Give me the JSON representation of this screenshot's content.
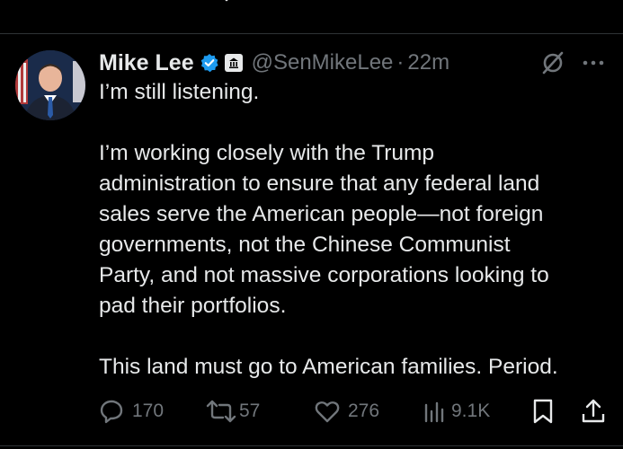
{
  "tweet": {
    "author": {
      "display_name": "Mike Lee",
      "handle": "@SenMikeLee",
      "verified": true,
      "government_badge": true,
      "avatar_icon": "senator-portrait"
    },
    "separator": "·",
    "timestamp": "22m",
    "text": {
      "para1": [
        "I’m still listening."
      ],
      "para2": [
        "I’m working closely with the Trump",
        "administration to ensure that any federal land",
        "sales serve the American people—not foreign",
        "governments, not the Chinese Communist",
        "Party, and not massive corporations looking to",
        "pad their portfolios."
      ],
      "para3": [
        "This land must go to American families. Period."
      ]
    },
    "metrics": {
      "replies": "170",
      "reposts": "57",
      "likes": "276",
      "views": "9.1K"
    }
  },
  "colors": {
    "background": "#000000",
    "text_primary": "#e7e9ea",
    "text_secondary": "#71767b",
    "verified_blue": "#1d9bf0",
    "divider": "#2f3336"
  },
  "icons": {
    "reply": "reply-icon",
    "repost": "repost-icon",
    "like": "heart-icon",
    "views": "views-icon",
    "bookmark": "bookmark-icon",
    "share": "share-icon",
    "grok": "grok-icon",
    "more": "more-icon"
  }
}
